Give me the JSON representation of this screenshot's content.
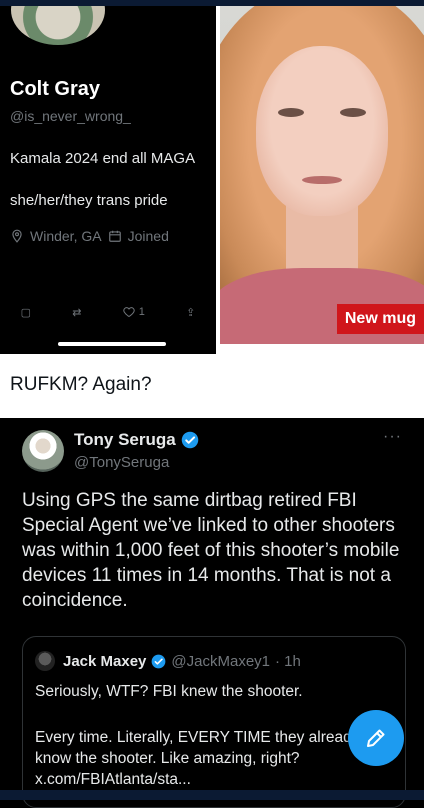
{
  "embedded_profile": {
    "name": "Colt Gray",
    "handle": "@is_never_wrong_",
    "bio_line1": "Kamala 2024 end all MAGA",
    "bio_line2": "she/her/they trans pride",
    "location": "Winder, GA",
    "joined": "Joined",
    "like_count": "1"
  },
  "embedded_photo": {
    "news_label": "New mug"
  },
  "caption": {
    "text": "RUFKM? Again?"
  },
  "tweet": {
    "author_name": "Tony Seruga",
    "author_handle": "@TonySeruga",
    "more": "···",
    "body": "Using GPS the same dirtbag retired FBI Special Agent we’ve linked to other shooters was within 1,000 feet of this shooter’s mobile devices 11 times in 14 months. That is not a coincidence."
  },
  "quoted_tweet": {
    "author_name": "Jack Maxey",
    "author_handle": "@JackMaxey1",
    "time": "· 1h",
    "body_line1": "Seriously, WTF? FBI knew the shooter.",
    "body_line2": "Every time. Literally, EVERY TIME they already know the shooter. Like amazing, right? x.com/FBIAtlanta/sta..."
  },
  "colors": {
    "accent": "#1d9bf0",
    "news_red": "#d0161b",
    "muted": "#71767b"
  }
}
